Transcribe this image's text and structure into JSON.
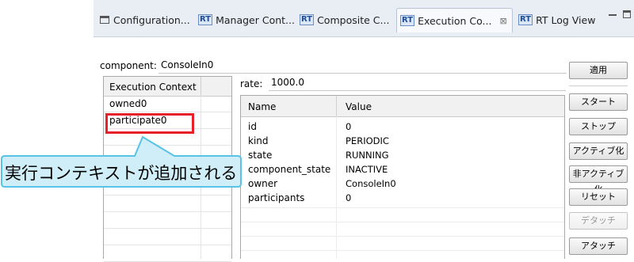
{
  "tabs": [
    {
      "label": "Configuration...",
      "icon": "window-icon"
    },
    {
      "label": "Manager Cont...",
      "icon": "rt-icon"
    },
    {
      "label": "Composite C...",
      "icon": "rt-icon"
    },
    {
      "label": "Execution Co...",
      "icon": "rt-icon",
      "active": true
    },
    {
      "label": "RT Log View",
      "icon": "rt-icon"
    }
  ],
  "rt_icon_text": "RT",
  "tab_close_glyph": "⊠",
  "component": {
    "label": "component:",
    "value": "ConsoleIn0"
  },
  "ec_table": {
    "header": "Execution Context",
    "rows": [
      "owned0",
      "participate0"
    ]
  },
  "rate": {
    "label": "rate:",
    "value": "1000.0"
  },
  "properties": {
    "headers": [
      "Name",
      "Value"
    ],
    "rows": [
      {
        "name": "id",
        "value": "0"
      },
      {
        "name": "kind",
        "value": "PERIODIC"
      },
      {
        "name": "state",
        "value": "RUNNING"
      },
      {
        "name": "component_state",
        "value": "INACTIVE"
      },
      {
        "name": "owner",
        "value": "ConsoleIn0"
      },
      {
        "name": "participants",
        "value": "0"
      }
    ]
  },
  "buttons": {
    "apply": "適用",
    "start": "スタート",
    "stop": "ストップ",
    "activate": "アクティブ化",
    "deactivate": "非アクティブ化",
    "reset": "リセット",
    "detach": "デタッチ",
    "attach": "アタッチ"
  },
  "annotation": {
    "text": "実行コンテキストが追加される"
  },
  "colors": {
    "highlight": "#e8202a",
    "callout_fill": "#cfeef8",
    "callout_stroke": "#58c3e6"
  }
}
